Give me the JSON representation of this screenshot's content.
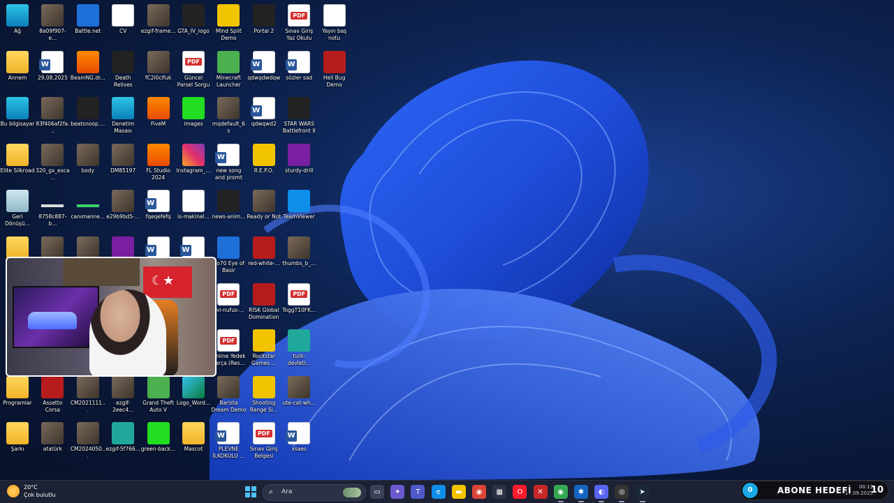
{
  "desktop": {
    "icons": [
      {
        "label": "Ağ",
        "glyph": "g-monitor",
        "col": 0,
        "row": 0
      },
      {
        "label": "8a09f907-e...",
        "glyph": "g-photo",
        "col": 1,
        "row": 0
      },
      {
        "label": "Battle.net",
        "glyph": "g-blue",
        "col": 2,
        "row": 0
      },
      {
        "label": "CV",
        "glyph": "g-doc",
        "col": 3,
        "row": 0
      },
      {
        "label": "ezgif-frame...",
        "glyph": "g-photo",
        "col": 4,
        "row": 0
      },
      {
        "label": "GTA_IV_logo",
        "glyph": "g-dark",
        "col": 5,
        "row": 0
      },
      {
        "label": "Mind Split Demo",
        "glyph": "g-yellow",
        "col": 6,
        "row": 0
      },
      {
        "label": "Portal 2",
        "glyph": "g-dark",
        "col": 7,
        "row": 0
      },
      {
        "label": "Sınav Giriş Yaz Okulu",
        "glyph": "g-pdf",
        "col": 8,
        "row": 0
      },
      {
        "label": "Yayın baş notu",
        "glyph": "g-doc",
        "col": 9,
        "row": 0
      },
      {
        "label": "Annem",
        "glyph": "g-folder",
        "col": 0,
        "row": 1
      },
      {
        "label": "29,08,2025",
        "glyph": "g-word",
        "col": 1,
        "row": 1
      },
      {
        "label": "BeamNG.dr...",
        "glyph": "g-orange",
        "col": 2,
        "row": 1
      },
      {
        "label": "Death Relives",
        "glyph": "g-dark",
        "col": 3,
        "row": 1
      },
      {
        "label": "fC2i0clfuk",
        "glyph": "g-photo",
        "col": 4,
        "row": 1
      },
      {
        "label": "Güncel Parsel Sorgu",
        "glyph": "g-pdf",
        "col": 5,
        "row": 1
      },
      {
        "label": "Minecraft Launcher",
        "glyph": "g-mc",
        "col": 6,
        "row": 1
      },
      {
        "label": "qdwqdwdqw",
        "glyph": "g-word",
        "col": 7,
        "row": 1
      },
      {
        "label": "sözler sad",
        "glyph": "g-word",
        "col": 8,
        "row": 1
      },
      {
        "label": "Hell Bug Demo",
        "glyph": "g-red",
        "col": 9,
        "row": 1
      },
      {
        "label": "Bu bilgisayar",
        "glyph": "g-monitor",
        "col": 0,
        "row": 2
      },
      {
        "label": "83f406af2fa...",
        "glyph": "g-photo",
        "col": 1,
        "row": 2
      },
      {
        "label": "beatsnoop....",
        "glyph": "g-dark",
        "col": 2,
        "row": 2
      },
      {
        "label": "Denetim Masası",
        "glyph": "g-monitor",
        "col": 3,
        "row": 2
      },
      {
        "label": "FiveM",
        "glyph": "g-orange",
        "col": 4,
        "row": 2
      },
      {
        "label": "images",
        "glyph": "g-green",
        "col": 5,
        "row": 2
      },
      {
        "label": "mqdefault_6s",
        "glyph": "g-photo",
        "col": 6,
        "row": 2
      },
      {
        "label": "qdwqwd2",
        "glyph": "g-word",
        "col": 7,
        "row": 2
      },
      {
        "label": "STAR WARS Battlefront II",
        "glyph": "g-dark",
        "col": 8,
        "row": 2
      },
      {
        "label": "Elite Silkroad",
        "glyph": "g-folder",
        "col": 0,
        "row": 3
      },
      {
        "label": "320_gx_exca...",
        "glyph": "g-photo",
        "col": 1,
        "row": 3
      },
      {
        "label": "body",
        "glyph": "g-photo",
        "col": 2,
        "row": 3
      },
      {
        "label": "DM85197",
        "glyph": "g-photo",
        "col": 3,
        "row": 3
      },
      {
        "label": "FL Studio 2024",
        "glyph": "g-orange",
        "col": 4,
        "row": 3
      },
      {
        "label": "Instagram_...",
        "glyph": "g-insta",
        "col": 5,
        "row": 3
      },
      {
        "label": "new song and promt",
        "glyph": "g-word",
        "col": 6,
        "row": 3
      },
      {
        "label": "R.E.P.O.",
        "glyph": "g-yellow",
        "col": 7,
        "row": 3
      },
      {
        "label": "sturdy-drill",
        "glyph": "g-purple",
        "col": 8,
        "row": 3
      },
      {
        "label": "Geri Dönüşü...",
        "glyph": "g-bin",
        "col": 0,
        "row": 4
      },
      {
        "label": "8758c887-b...",
        "glyph": "g-strip",
        "col": 1,
        "row": 4
      },
      {
        "label": "canımanne...",
        "glyph": "g-strip greenish",
        "col": 2,
        "row": 4
      },
      {
        "label": "e29b9bd5-...",
        "glyph": "g-photo",
        "col": 3,
        "row": 4
      },
      {
        "label": "fqeqefefq",
        "glyph": "g-word",
        "col": 4,
        "row": 4
      },
      {
        "label": "is-makinel...",
        "glyph": "g-doc",
        "col": 5,
        "row": 4
      },
      {
        "label": "news-anim...",
        "glyph": "g-dark",
        "col": 6,
        "row": 4
      },
      {
        "label": "Ready or Not",
        "glyph": "g-photo",
        "col": 7,
        "row": 4
      },
      {
        "label": "TeamViewer",
        "glyph": "g-tv",
        "col": 8,
        "row": 4
      },
      {
        "label": "",
        "glyph": "g-folder",
        "col": 0,
        "row": 5
      },
      {
        "label": "",
        "glyph": "g-photo",
        "col": 1,
        "row": 5
      },
      {
        "label": "",
        "glyph": "g-photo",
        "col": 2,
        "row": 5
      },
      {
        "label": "",
        "glyph": "g-purple",
        "col": 3,
        "row": 5
      },
      {
        "label": "",
        "glyph": "g-word",
        "col": 4,
        "row": 5
      },
      {
        "label": "",
        "glyph": "g-word",
        "col": 5,
        "row": 5
      },
      {
        "label": "No70 Eye of Basir",
        "glyph": "g-blue",
        "col": 6,
        "row": 5
      },
      {
        "label": "red-white-...",
        "glyph": "g-red",
        "col": 7,
        "row": 5
      },
      {
        "label": "thumbs_b_...",
        "glyph": "g-photo",
        "col": 8,
        "row": 5
      },
      {
        "label": "nvi-nufus-...",
        "glyph": "g-pdf",
        "col": 6,
        "row": 6
      },
      {
        "label": "RISK Global Domination",
        "glyph": "g-red",
        "col": 7,
        "row": 6
      },
      {
        "label": "ToggT10FK...",
        "glyph": "g-pdf",
        "col": 8,
        "row": 6
      },
      {
        "label": "Online Yedek Parça (Res...",
        "glyph": "g-pdf",
        "col": 6,
        "row": 7
      },
      {
        "label": "Rockstar Games ...",
        "glyph": "g-yellow",
        "col": 7,
        "row": 7
      },
      {
        "label": "turk-devletl...",
        "glyph": "g-teal",
        "col": 8,
        "row": 7
      },
      {
        "label": "Programlar",
        "glyph": "g-folder",
        "col": 0,
        "row": 8
      },
      {
        "label": "Assetto Corsa",
        "glyph": "g-red",
        "col": 1,
        "row": 8
      },
      {
        "label": "CM2021111...",
        "glyph": "g-photo",
        "col": 2,
        "row": 8
      },
      {
        "label": "ezgif-2eec4...",
        "glyph": "g-photo",
        "col": 3,
        "row": 8
      },
      {
        "label": "Grand Theft Auto V",
        "glyph": "g-mc",
        "col": 4,
        "row": 8
      },
      {
        "label": "Logo_Word...",
        "glyph": "g-edge",
        "col": 5,
        "row": 8
      },
      {
        "label": "Barista Dream Demo",
        "glyph": "g-photo",
        "col": 6,
        "row": 8
      },
      {
        "label": "Shooting Range Si...",
        "glyph": "g-yellow",
        "col": 7,
        "row": 8
      },
      {
        "label": "ute-cat-wh...",
        "glyph": "g-photo",
        "col": 8,
        "row": 8
      },
      {
        "label": "Şarkı",
        "glyph": "g-folder",
        "col": 0,
        "row": 9
      },
      {
        "label": "atatürk",
        "glyph": "g-photo",
        "col": 1,
        "row": 9
      },
      {
        "label": "CM2024050...",
        "glyph": "g-photo",
        "col": 2,
        "row": 9
      },
      {
        "label": "ezgif-5f766...",
        "glyph": "g-teal",
        "col": 3,
        "row": 9
      },
      {
        "label": "green-back...",
        "glyph": "g-green",
        "col": 4,
        "row": 9
      },
      {
        "label": "Mascot",
        "glyph": "g-folder",
        "col": 5,
        "row": 9
      },
      {
        "label": "PLEVNE İLKOKULU ...",
        "glyph": "g-word",
        "col": 6,
        "row": 9
      },
      {
        "label": "Sınav Giriş Belgesi",
        "glyph": "g-pdf",
        "col": 7,
        "row": 9
      },
      {
        "label": "xsaes",
        "glyph": "g-word",
        "col": 8,
        "row": 9
      }
    ]
  },
  "weather": {
    "temp": "20°C",
    "desc": "Çok bulutlu"
  },
  "search": {
    "placeholder": "Ara"
  },
  "taskbar_apps": [
    {
      "name": "task-view-icon",
      "glyph": "▭",
      "bg": "#3a4158"
    },
    {
      "name": "copilot-icon",
      "glyph": "✦",
      "bg": "#6a5acd"
    },
    {
      "name": "teams-icon",
      "glyph": "T",
      "bg": "#5059c9"
    },
    {
      "name": "edge-icon",
      "glyph": "e",
      "bg": "#0e8ee9"
    },
    {
      "name": "file-explorer-icon",
      "glyph": "▬",
      "bg": "#f2c400"
    },
    {
      "name": "chrome-icon",
      "glyph": "◉",
      "bg": "#db4437"
    },
    {
      "name": "store-icon",
      "glyph": "▦",
      "bg": "#2b3246"
    },
    {
      "name": "opera-icon",
      "glyph": "O",
      "bg": "#ff1b2d"
    },
    {
      "name": "app-red-icon",
      "glyph": "✕",
      "bg": "#c62828"
    },
    {
      "name": "chrome-alt-icon",
      "glyph": "◉",
      "bg": "#34a853"
    },
    {
      "name": "app-gear-icon",
      "glyph": "✱",
      "bg": "#1565c0"
    },
    {
      "name": "discord-icon",
      "glyph": "◐",
      "bg": "#5865f2"
    },
    {
      "name": "obs-icon",
      "glyph": "◎",
      "bg": "#333"
    },
    {
      "name": "steam-icon",
      "glyph": "➤",
      "bg": "#1b2838"
    }
  ],
  "abone": {
    "badge": "0",
    "label": "ABONE HEDEFİ",
    "count": "10"
  },
  "clock": {
    "time": "00:13",
    "date": "17.09.2025"
  }
}
